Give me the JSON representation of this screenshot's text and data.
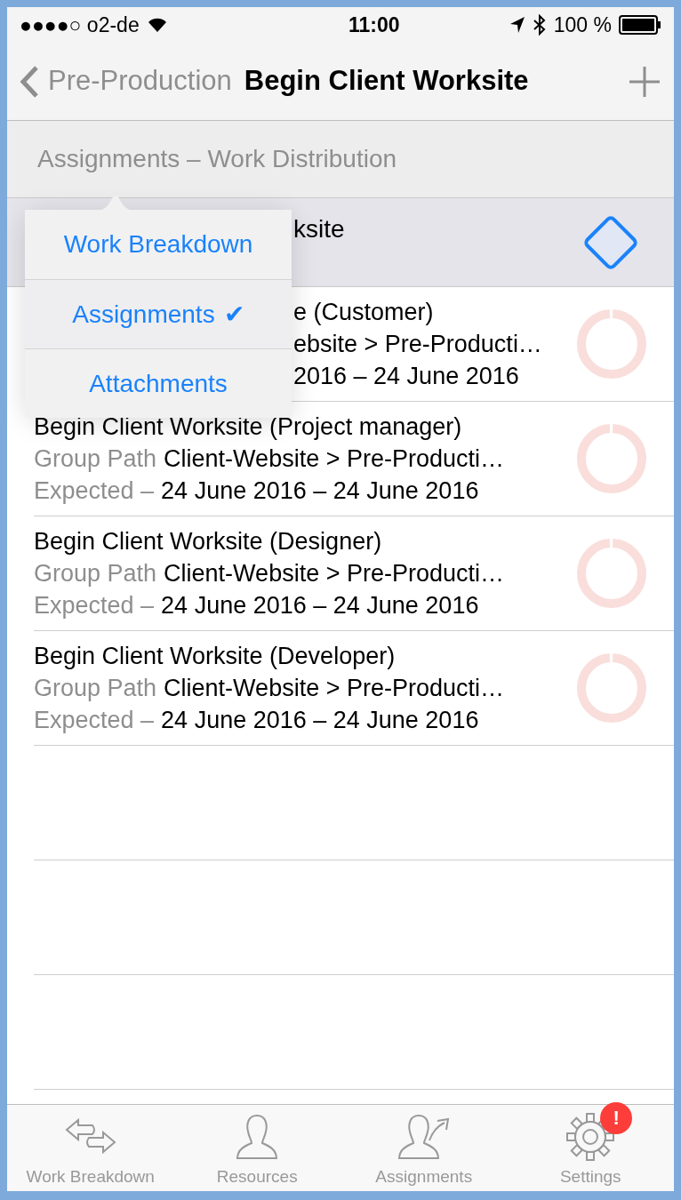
{
  "status_bar": {
    "carrier": "●●●●○ o2-de",
    "time": "11:00",
    "battery": "100 %"
  },
  "nav": {
    "back": "Pre-Production",
    "title": "Begin Client Worksite"
  },
  "section": {
    "title": "Assignments – Work Distribution"
  },
  "task": {
    "title": "ksite"
  },
  "rows": [
    {
      "kind": "covered",
      "title": "e (Customer)",
      "path": "ebsite > Pre-Producti…",
      "dates": "2016 – 24 June 2016"
    },
    {
      "kind": "full",
      "title": "Begin Client Worksite (Project manager)",
      "path_label": "Group Path",
      "path": "Client-Website > Pre-Producti…",
      "expected_label": "Expected –",
      "dates": "24 June 2016 – 24 June 2016"
    },
    {
      "kind": "full",
      "title": "Begin Client Worksite (Designer)",
      "path_label": "Group Path",
      "path": "Client-Website > Pre-Producti…",
      "expected_label": "Expected –",
      "dates": "24 June 2016 – 24 June 2016"
    },
    {
      "kind": "full",
      "title": "Begin Client Worksite (Developer)",
      "path_label": "Group Path",
      "path": "Client-Website > Pre-Producti…",
      "expected_label": "Expected –",
      "dates": "24 June 2016 – 24 June 2016"
    }
  ],
  "popover": {
    "check": "✔",
    "items": [
      {
        "label": "Work Breakdown",
        "selected": false
      },
      {
        "label": "Assignments",
        "selected": true
      },
      {
        "label": "Attachments",
        "selected": false
      }
    ]
  },
  "tab_bar": {
    "items": [
      {
        "label": "Work Breakdown",
        "kind": "arrows"
      },
      {
        "label": "Resources",
        "kind": "person"
      },
      {
        "label": "Assignments",
        "kind": "assign"
      },
      {
        "label": "Settings",
        "kind": "gear",
        "badge": "!"
      }
    ]
  }
}
